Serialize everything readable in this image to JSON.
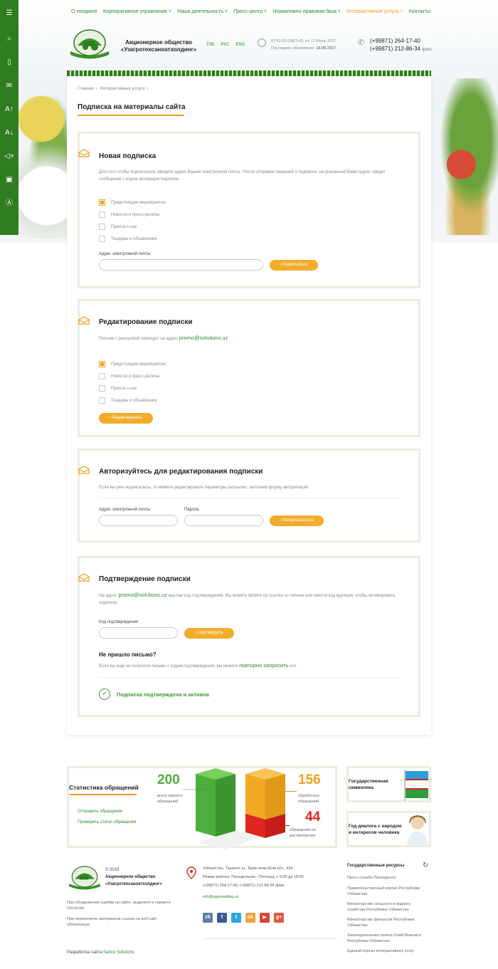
{
  "toolbar": {
    "items": [
      {
        "icon": "menu-icon",
        "glyph": "☰"
      },
      {
        "icon": "search-icon",
        "glyph": "⌕"
      },
      {
        "icon": "mobile-icon",
        "glyph": "▯"
      },
      {
        "icon": "chat-icon",
        "glyph": "✉"
      },
      {
        "icon": "font-increase-icon",
        "glyph": "A↑"
      },
      {
        "icon": "font-decrease-icon",
        "glyph": "A↓"
      },
      {
        "icon": "sound-off-icon",
        "glyph": "◁×"
      },
      {
        "icon": "image-off-icon",
        "glyph": "▣"
      },
      {
        "icon": "contrast-icon",
        "glyph": "Ⓐ"
      }
    ]
  },
  "nav": {
    "items": [
      "О холдинге",
      "Корпоративное управление",
      "Наша деятельность",
      "Пресс-центр",
      "Нормативно-правовая база",
      "Интерактивные услуги",
      "Контакты"
    ],
    "active_index": 5
  },
  "header": {
    "org_name_line1": "Акционерное общество",
    "org_name_line2": "«Узагротехсаноатхолдинг»",
    "langs": [
      "ЎЗБ",
      "РУС",
      "ENG"
    ],
    "datetime": "07:52:02 (GMT+5), пт. 17 Июнь 2017",
    "updated_label": "Последнее обновление:",
    "updated_value": "16.06.2017",
    "phone1": "(+99871) 264-17-40",
    "phone2": "(+99871) 212-86-34",
    "phone2_suffix": "факс"
  },
  "breadcrumbs": [
    "Главная",
    "Интерактивные услуги"
  ],
  "page_title": "Подписка на материалы сайта",
  "new_sub": {
    "title": "Новая подписка",
    "desc": "Для того чтобы подписаться, введите адрес Вашей электронной почты. После отправки сведений о подписке, на указанный Вами адрес придет сообщение с кодом активации подписки.",
    "options": [
      "Предстоящие мероприятия",
      "Новости и пресс-релизы",
      "Пресса о нас",
      "Тендеры и объявления"
    ],
    "email_label": "Адрес электронной почты",
    "button": "Подписаться"
  },
  "edit_sub": {
    "title": "Редактирование подписки",
    "desc_prefix": "Письма с рассылкой приходят на адрес",
    "email": "promo@solutions.uz",
    "options": [
      "Предстоящие мероприятия",
      "Новости и пресс-релизы",
      "Пресса о нас",
      "Тендеры и объявления"
    ],
    "button": "Редактировать"
  },
  "auth_sub": {
    "title": "Авторизуйтесь для редактирования подписки",
    "desc": "Если вы уже подписались, то можете редактировать параметры рассылки, заполнив форму авторизации.",
    "email_label": "Адрес электронной почты",
    "password_label": "Пароль",
    "button": "Авторизоваться"
  },
  "confirm_sub": {
    "title": "Подтверждение подписки",
    "desc_prefix": "На адрес",
    "email": "promo@solutions.uz",
    "desc_suffix": "выслан код подтверждения. Вы можете пройти по ссылке из письма или ввести код вручную, чтобы активировать подписку.",
    "code_label": "Код подтверждения",
    "button": "Подтвердить",
    "no_mail_title": "Не пришло письмо?",
    "no_mail_prefix": "Если вы еще не получили письмо с кодом подтверждения, вы можете",
    "no_mail_link": "повторно запросить",
    "no_mail_suffix": "его.",
    "status": "Подписка подтверждена и активна"
  },
  "stats": {
    "title": "Статистика обращений",
    "link1": "Отправить обращение",
    "link2": "Проверить статус обращения",
    "total": "200",
    "total_caption_1": "всего принято",
    "total_caption_2": "обращений",
    "processed": "156",
    "processed_caption_1": "обработано",
    "processed_caption_2": "обращений",
    "pending": "44",
    "pending_caption_1": "обращений на",
    "pending_caption_2": "рассмотрении",
    "colors": {
      "green": "#4caf3c",
      "orange": "#f0a020",
      "red": "#e0261e"
    }
  },
  "side_cards": [
    {
      "line1": "Государственная",
      "line2": "символика"
    },
    {
      "line1": "Год диалога с народом",
      "line2": "и интересов человека"
    }
  ],
  "footer": {
    "copyright": "© 2019",
    "org_line1": "Акционерное общество",
    "org_line2": "«Узагротехсаноатхолдинг»",
    "note1": "При обнаружении ошибки на сайте, выделите и нажмите Ctrl+Enter",
    "note2": "При перепечатке материалов ссылка на веб-сайт обязательна",
    "address": "Узбекистан, Ташкент ш., Буюк ипак йўли кўч., 434",
    "hours": "Режим работы: Понедельник - Пятница, с 9:00 до 18:00",
    "phones": "(+99871) 264-17-40, (+99871) 212-86-34 факс",
    "mail": "info@agroholding.uz",
    "social": [
      {
        "icon": "vk-icon",
        "label": "vk",
        "color": "#5b7fa6"
      },
      {
        "icon": "facebook-icon",
        "label": "f",
        "color": "#3b5998"
      },
      {
        "icon": "twitter-icon",
        "label": "t",
        "color": "#2ea7e0"
      },
      {
        "icon": "odnoklassniki-icon",
        "label": "ok",
        "color": "#f2a13a"
      },
      {
        "icon": "youtube-icon",
        "label": "▶",
        "color": "#d9453a"
      },
      {
        "icon": "google-plus-icon",
        "label": "g+",
        "color": "#dd5a3f"
      }
    ],
    "dev_prefix": "Разработка сайта",
    "dev_name": "Sarkor Solutions"
  },
  "resources": {
    "title": "Государственные ресурсы",
    "items": [
      "Пресс-служба Президента",
      "Правительственный портал Республики Узбекистан",
      "Министерство сельского и водного хозяйства Республики Узбекистан",
      "Министерство финансов Республики Узбекистан",
      "Законодательная палата Олий Мажлиса Республики Узбекистан",
      "Единый портал интерактивных услуг"
    ]
  }
}
